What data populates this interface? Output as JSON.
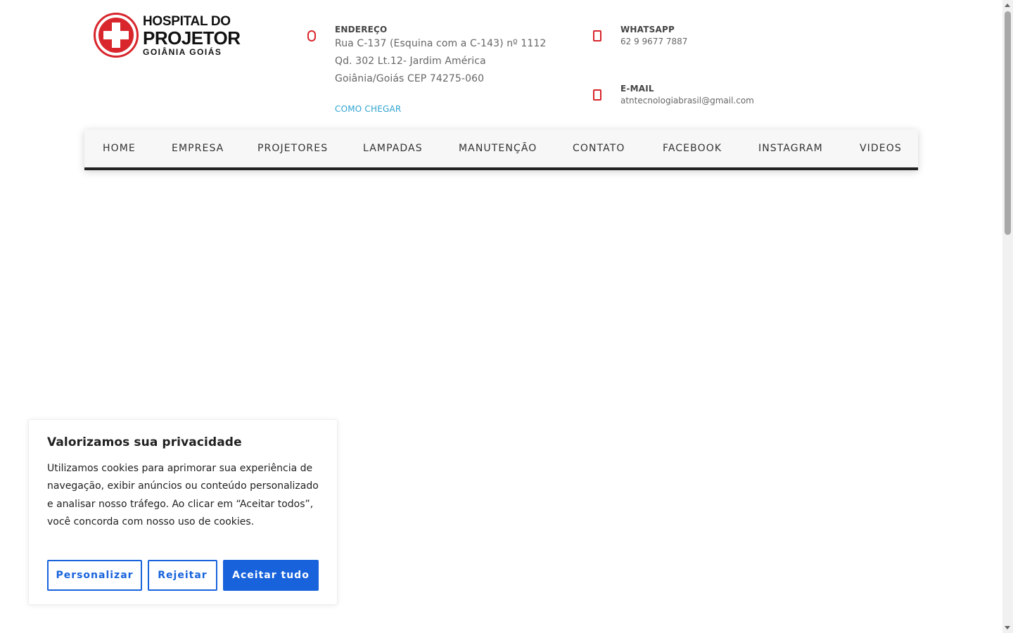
{
  "header": {
    "logo": {
      "line1": "HOSPITAL DO",
      "line2": "PROJETOR",
      "line3": "GOIÂNIA GOIÁS"
    },
    "address": {
      "label": "ENDEREÇO",
      "line1": "Rua C-137 (Esquina com a C-143) nº 1112",
      "line2": "Qd. 302 Lt.12- Jardim América",
      "line3": "Goiânia/Goiás CEP 74275-060",
      "link": "COMO CHEGAR"
    },
    "whatsapp": {
      "label": "WHATSAPP",
      "value": "62 9 9677 7887"
    },
    "email": {
      "label": "E-MAIL",
      "value": "atntecnologiabrasil@gmail.com"
    },
    "icon_color": "#d8262c"
  },
  "nav": {
    "items": [
      "HOME",
      "EMPRESA",
      "PROJETORES",
      "LAMPADAS",
      "MANUTENÇÃO",
      "CONTATO",
      "FACEBOOK",
      "INSTAGRAM",
      "VIDEOS"
    ]
  },
  "cookie": {
    "title": "Valorizamos sua privacidade",
    "text": "Utilizamos cookies para aprimorar sua experiência de navegação, exibir anúncios ou conteúdo personalizado e analisar nosso tráfego. Ao clicar em “Aceitar todos”, você concorda com nosso uso de cookies.",
    "customize": "Personalizar",
    "reject": "Rejeitar",
    "accept": "Aceitar tudo",
    "accent": "#1863dc"
  }
}
